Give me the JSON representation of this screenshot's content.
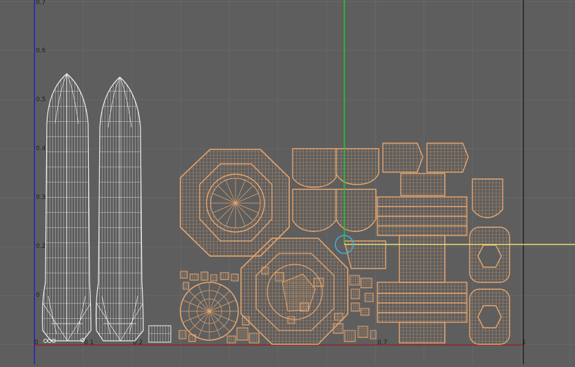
{
  "viewport": {
    "name": "UV Texture Editor",
    "y_axis_labels": [
      "0.7",
      "0.6",
      "0.5",
      "0.4",
      "0.3",
      "0.2",
      "0"
    ],
    "x_axis_labels": [
      "0",
      "0.1",
      "0.2",
      "0.7",
      "1"
    ],
    "colors": {
      "background": "#5e5e5e",
      "grid": "#6f6f6f",
      "uv_shell_selected": "#e8a66e",
      "uv_shell_unselected": "#f2f2f2",
      "u_axis": "#c02020",
      "v_axis_left": "#2020c0",
      "pivot_v": "#22cc33",
      "pivot_u": "#e6e070",
      "manipulator": "#39b6d6"
    }
  }
}
